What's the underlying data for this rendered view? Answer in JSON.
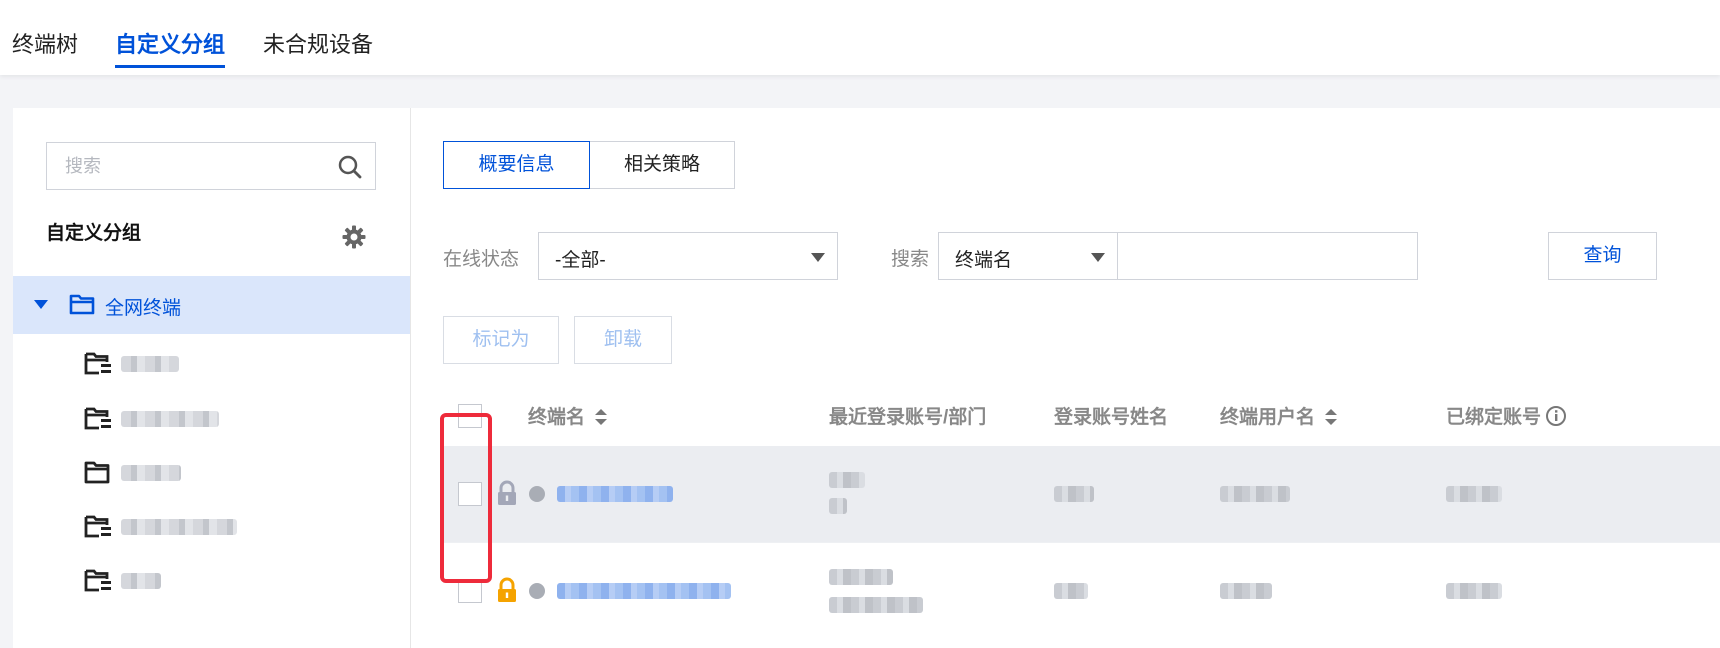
{
  "top_tabs": [
    {
      "label": "终端树"
    },
    {
      "label": "自定义分组"
    },
    {
      "label": "未合规设备"
    }
  ],
  "sidebar": {
    "search_placeholder": "搜索",
    "group_title": "自定义分组",
    "root": {
      "label": "全网终端"
    },
    "items": [
      {
        "icon": "shared-folder-icon",
        "label": "██████"
      },
      {
        "icon": "shared-folder-icon",
        "label": "██████████"
      },
      {
        "icon": "folder-icon",
        "label": "██████"
      },
      {
        "icon": "shared-folder-icon",
        "label": "████████████"
      },
      {
        "icon": "shared-folder-icon",
        "label": "████"
      }
    ]
  },
  "main": {
    "tabs": [
      {
        "label": "概要信息"
      },
      {
        "label": "相关策略"
      }
    ],
    "filters": {
      "online_status_label": "在线状态",
      "online_status_value": "-全部-",
      "search_label": "搜索",
      "search_field_value": "终端名",
      "search_text": "",
      "query_button": "查询"
    },
    "actions": {
      "mark_as": "标记为",
      "uninstall": "卸载"
    },
    "table": {
      "columns": [
        "终端名",
        "最近登录账号/部门",
        "登录账号姓名",
        "终端用户名",
        "已绑定账号"
      ],
      "rows": [
        {
          "lock": "gray",
          "online": false,
          "name": "██████████",
          "account": "████",
          "dept": "██",
          "real_name": "████",
          "user": "████████",
          "bound": "██████"
        },
        {
          "lock": "yellow",
          "online": false,
          "name": "████████████████",
          "account": "███████",
          "dept": "██████████",
          "real_name": "████",
          "user": "██████",
          "bound": "██████"
        }
      ]
    }
  },
  "colors": {
    "accent": "#0052d9",
    "highlight": "#ee2b3b",
    "lock_gray": "#a3a7b8",
    "lock_yellow": "#f5a300"
  }
}
